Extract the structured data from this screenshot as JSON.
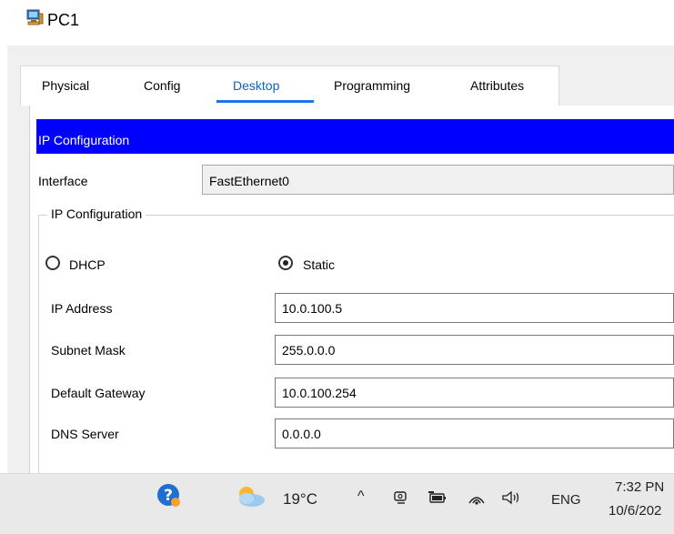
{
  "window": {
    "title": "PC1",
    "icon": "pc-device-icon"
  },
  "tabs": [
    {
      "label": "Physical",
      "active": false
    },
    {
      "label": "Config",
      "active": false
    },
    {
      "label": "Desktop",
      "active": true
    },
    {
      "label": "Programming",
      "active": false
    },
    {
      "label": "Attributes",
      "active": false
    }
  ],
  "ip_config": {
    "header": "IP Configuration",
    "interface_label": "Interface",
    "interface_value": "FastEthernet0",
    "group_title": "IP Configuration",
    "dhcp_label": "DHCP",
    "static_label": "Static",
    "mode": "Static",
    "ip_address_label": "IP Address",
    "ip_address": "10.0.100.5",
    "subnet_mask_label": "Subnet Mask",
    "subnet_mask": "255.0.0.0",
    "gateway_label": "Default Gateway",
    "gateway": "10.0.100.254",
    "dns_label": "DNS Server",
    "dns": "0.0.0.0"
  },
  "taskbar": {
    "temperature": "19°C",
    "language": "ENG",
    "time": "7:32 PN",
    "date": "10/6/202"
  },
  "colors": {
    "header_bar": "#0000ff",
    "active_tab": "#1a73e8",
    "taskbar": "#e9e9ea"
  }
}
